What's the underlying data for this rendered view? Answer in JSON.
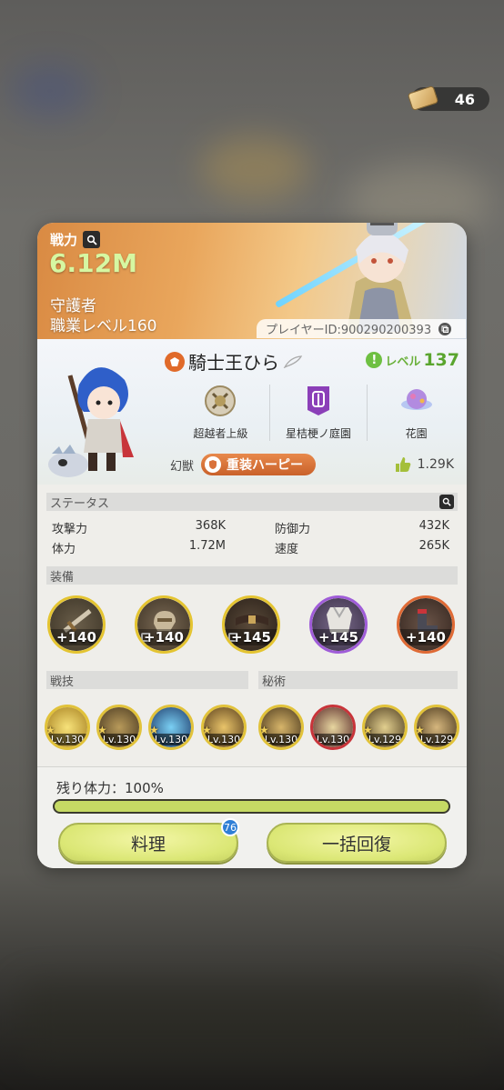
{
  "currency": {
    "amount": "46",
    "icon": "ticket-icon"
  },
  "header": {
    "power_label": "戦力",
    "power_value": "6.12M",
    "class_name": "守護者",
    "job_level": "職業レベル160",
    "player_id": "プレイヤーID:900290200393"
  },
  "profile": {
    "name": "騎士王ひら",
    "level_label": "レベル",
    "level_value": "137",
    "badges": [
      {
        "label": "超越者上級",
        "icon": "rank-emblem-icon"
      },
      {
        "label": "星桔梗ノ庭園",
        "icon": "guild-banner-icon"
      },
      {
        "label": "花園",
        "icon": "planet-icon"
      }
    ],
    "phantom_label": "幻獣",
    "phantom_name": "重装ハーピー",
    "likes": "1.29K"
  },
  "status": {
    "title": "ステータス",
    "stats": [
      {
        "label": "攻撃力",
        "value": "368K"
      },
      {
        "label": "体力",
        "value": "1.72M"
      },
      {
        "label": "防御力",
        "value": "432K"
      },
      {
        "label": "速度",
        "value": "265K"
      }
    ]
  },
  "equipment": {
    "title": "装備",
    "items": [
      {
        "plus": "+140",
        "icon": "sword-icon"
      },
      {
        "plus": "+140",
        "icon": "gauntlet-icon"
      },
      {
        "plus": "+145",
        "icon": "belt-icon"
      },
      {
        "plus": "+145",
        "icon": "armor-icon"
      },
      {
        "plus": "+140",
        "icon": "boots-icon"
      }
    ]
  },
  "skills": {
    "combat_title": "戦技",
    "secret_title": "秘術",
    "items": [
      {
        "lv": "Lv.130"
      },
      {
        "lv": "Lv.130"
      },
      {
        "lv": "Lv.130"
      },
      {
        "lv": "Lv.130"
      },
      {
        "lv": "Lv.130"
      },
      {
        "lv": "Lv.130"
      },
      {
        "lv": "Lv.129"
      },
      {
        "lv": "Lv.129"
      }
    ]
  },
  "footer": {
    "stamina_label": "残り体力：100%",
    "stamina_fraction": 1.0,
    "cook_button": "料理",
    "cook_badge": "76",
    "recover_button": "一括回復"
  },
  "colors": {
    "accent_green": "#d6f7a2",
    "button_yellow": "#dbe775",
    "phantom_orange": "#d9713a"
  }
}
